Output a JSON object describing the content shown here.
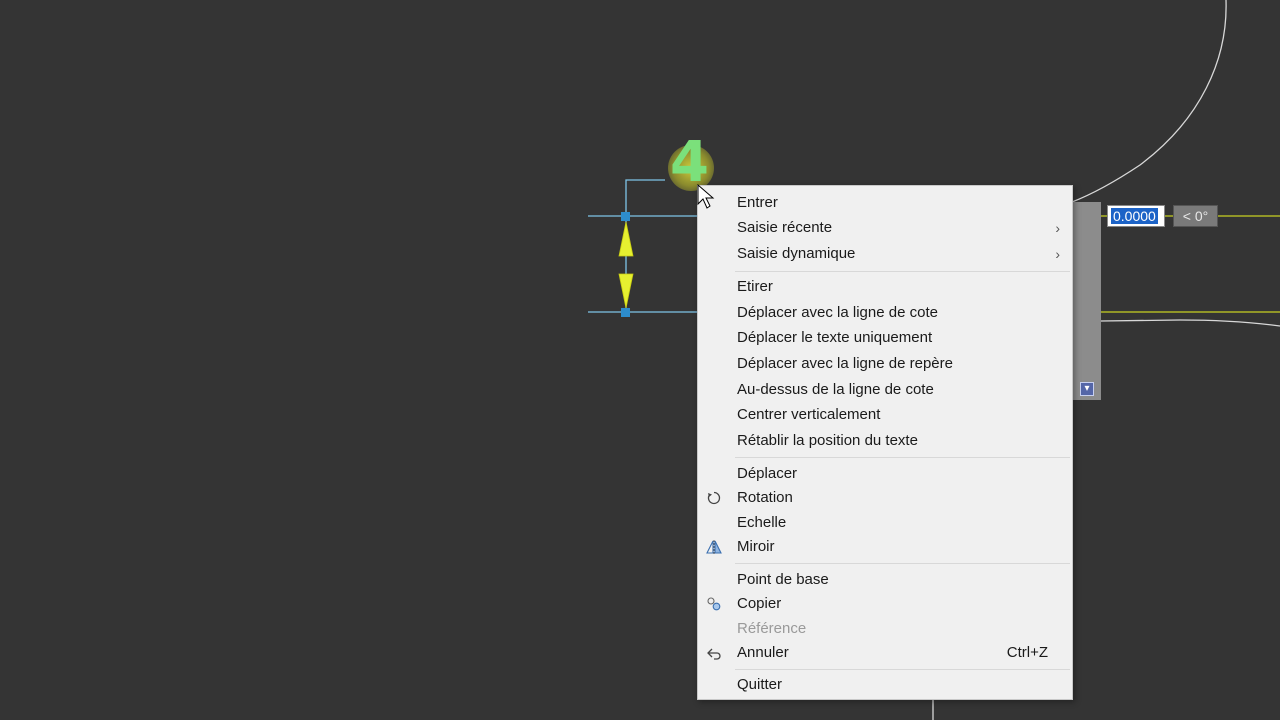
{
  "dynamic_input": {
    "distance_value": "0.0000",
    "angle_value": "< 0°"
  },
  "dimension_text": "4",
  "panel_icon": "download-icon",
  "colors": {
    "background": "#343434",
    "menu_background": "#f0f0f0",
    "dimension_lines": "#7ec4e8",
    "arrow_fill": "#e6f030",
    "selection_highlight": "#1c63c7"
  },
  "context_menu": {
    "items": [
      {
        "label": "Entrer"
      },
      {
        "label": "Saisie récente",
        "submenu": true
      },
      {
        "label": "Saisie dynamique",
        "submenu": true
      },
      {
        "label": "Etirer"
      },
      {
        "label": "Déplacer avec la ligne de cote"
      },
      {
        "label": "Déplacer le texte uniquement"
      },
      {
        "label": "Déplacer avec la ligne de repère"
      },
      {
        "label": "Au-dessus de la ligne de cote"
      },
      {
        "label": "Centrer verticalement"
      },
      {
        "label": "Rétablir la position du texte"
      },
      {
        "label": "Déplacer"
      },
      {
        "label": "Rotation",
        "icon": "rotate-icon"
      },
      {
        "label": "Echelle"
      },
      {
        "label": "Miroir",
        "icon": "mirror-icon"
      },
      {
        "label": "Point de base"
      },
      {
        "label": "Copier",
        "icon": "copy-icon"
      },
      {
        "label": "Référence",
        "disabled": true
      },
      {
        "label": "Annuler",
        "icon": "undo-icon",
        "shortcut": "Ctrl+Z"
      },
      {
        "label": "Quitter"
      }
    ],
    "submenu_arrow": "›"
  }
}
